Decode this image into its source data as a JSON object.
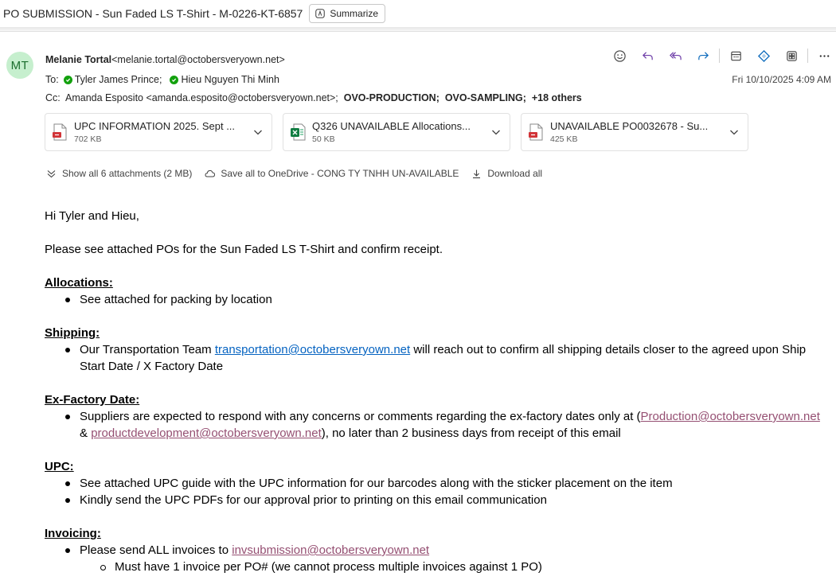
{
  "subject": "PO SUBMISSION - Sun Faded LS T-Shirt - M-0226-KT-6857",
  "summarize_label": "Summarize",
  "sender": {
    "initials": "MT",
    "name": "Melanie Tortal",
    "email": "<melanie.tortal@octobersveryown.net>"
  },
  "to": {
    "label": "To:",
    "recipients": [
      "Tyler James Prince;",
      "Hieu Nguyen Thi Minh"
    ]
  },
  "cc": {
    "label": "Cc:",
    "person": "Amanda Esposito <amanda.esposito@octobersveryown.net>;",
    "groups": [
      "OVO-PRODUCTION;",
      "OVO-SAMPLING;"
    ],
    "others": "+18 others"
  },
  "date": "Fri 10/10/2025 4:09 AM",
  "toolbar_icons": [
    "emoji-icon",
    "reply-icon",
    "reply-all-icon",
    "forward-icon",
    "calendar-icon",
    "loop-icon",
    "apps-icon",
    "more-icon"
  ],
  "attachments": [
    {
      "name": "UPC INFORMATION 2025. Sept ...",
      "size": "702 KB",
      "type": "pdf"
    },
    {
      "name": "Q326 UNAVAILABLE Allocations...",
      "size": "50 KB",
      "type": "excel"
    },
    {
      "name": "UNAVAILABLE PO0032678 - Su...",
      "size": "425 KB",
      "type": "pdf"
    }
  ],
  "attachment_actions": {
    "show_all": "Show all 6 attachments (2 MB)",
    "save_onedrive": "Save all to OneDrive - CONG TY TNHH UN-AVAILABLE",
    "download_all": "Download all"
  },
  "body": {
    "greeting": "Hi Tyler and Hieu,",
    "intro": "Please see attached POs for the Sun Faded LS T-Shirt and confirm receipt.",
    "allocations": {
      "heading": "Allocations:",
      "item1": "See attached for packing by location"
    },
    "shipping": {
      "heading": "Shipping:",
      "pre": "Our Transportation Team ",
      "link": "transportation@octobersveryown.net",
      "post": " will reach out to confirm all shipping details closer to the agreed upon Ship Start Date / X Factory Date"
    },
    "exfactory": {
      "heading": "Ex-Factory Date:",
      "pre": "Suppliers are expected to respond with any concerns or comments regarding the ex-factory dates only at (",
      "link1": "Production@octobersveryown.net",
      "mid": " & ",
      "link2": "productdevelopment@octobersveryown.net",
      "post": "), no later than 2 business days from receipt of this email"
    },
    "upc": {
      "heading": "UPC:",
      "item1": "See attached UPC guide with the UPC information for our barcodes along with the sticker placement on the item",
      "item2": "Kindly send the UPC PDFs for our approval prior to printing on this email communication"
    },
    "invoicing": {
      "heading": "Invoicing:",
      "pre": "Please send ALL invoices to ",
      "link": "invsubmission@octobersveryown.net",
      "sub1": "Must have 1 invoice per PO# (we cannot process multiple invoices against 1 PO)"
    }
  },
  "colors": {
    "avatar_bg": "#c6efce",
    "avatar_fg": "#1b6e2e",
    "link": "#0563c1",
    "visited_link": "#954f72",
    "presence": "#13a10e",
    "accent": "#0f6cbd"
  }
}
